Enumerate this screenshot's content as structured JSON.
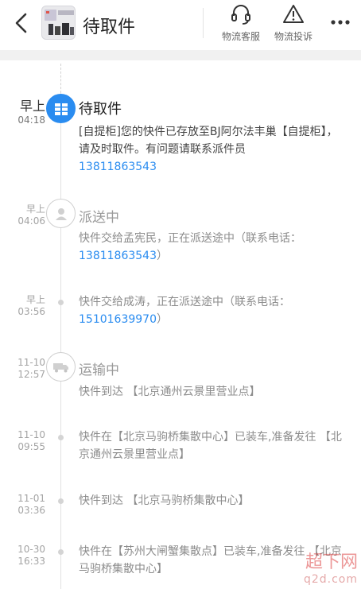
{
  "header": {
    "title": "待取件",
    "actions": [
      {
        "label": "物流客服",
        "icon": "headset-icon"
      },
      {
        "label": "物流投诉",
        "icon": "warning-icon"
      }
    ],
    "more_icon": "more-icon"
  },
  "colors": {
    "accent": "#2a8cf0",
    "muted": "#a4a4a4",
    "text": "#444444"
  },
  "events": [
    {
      "date": "早上",
      "time": "04:18",
      "status": "待取件",
      "icon": "locker-icon",
      "active": true,
      "text": "[自提柜]您的快件已存放至BJ阿尔法丰巢【自提柜】，请及时取件。有问题请联系派件员",
      "phone": "13811863543",
      "suffix": ""
    },
    {
      "date": "早上",
      "time": "04:06",
      "status": "派送中",
      "icon": "courier-icon",
      "text": "快件交给孟宪民，正在派送途中（联系电话：",
      "phone": "13811863543",
      "suffix": "）"
    },
    {
      "date": "早上",
      "time": "03:56",
      "text": "快件交给成涛，正在派送途中（联系电话：",
      "phone": "15101639970",
      "suffix": "）"
    },
    {
      "date": "11-10",
      "time": "12:57",
      "status": "运输中",
      "icon": "truck-icon",
      "text": "快件到达 【北京通州云景里营业点】"
    },
    {
      "date": "11-10",
      "time": "09:55",
      "text": "快件在【北京马驹桥集散中心】已装车,准备发往 【北京通州云景里营业点】"
    },
    {
      "date": "11-01",
      "time": "03:36",
      "text": "快件到达 【北京马驹桥集散中心】"
    },
    {
      "date": "10-30",
      "time": "16:33",
      "text": "快件在【苏州大闸蟹集散点】已装车,准备发往 【北京马驹桥集散中心】"
    }
  ],
  "watermark": {
    "main": "超下网",
    "sub": "q2d.com"
  }
}
